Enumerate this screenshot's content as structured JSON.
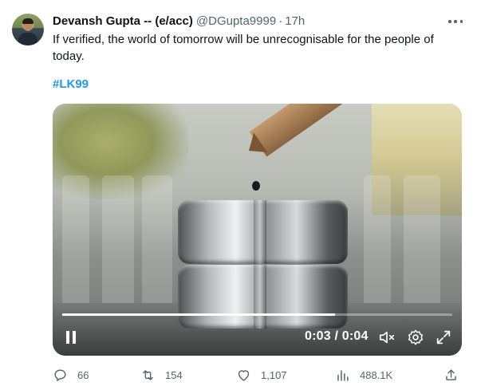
{
  "tweet": {
    "author_name": "Devansh Gupta -- (e/acc)",
    "handle": "@DGupta9999",
    "separator": "·",
    "time": "17h",
    "text": "If verified, the world of tomorrow will be unrecognisable for the people of today.",
    "hashtag": "#LK99"
  },
  "video": {
    "time_label": "0:03 / 0:04",
    "progress": 0.7,
    "playing": true
  },
  "actions": {
    "replies": "66",
    "retweets": "154",
    "likes": "1,107",
    "views": "488.1K"
  },
  "icons": {
    "more": "more-horizontal-icon",
    "pause": "pause-icon",
    "mute": "volume-muted-icon",
    "settings": "gear-icon",
    "fullscreen": "expand-icon",
    "reply": "reply-bubble-icon",
    "retweet": "retweet-icon",
    "like": "heart-icon",
    "views": "bar-chart-icon",
    "share": "share-icon"
  },
  "colors": {
    "accent": "#1d9bf0",
    "secondary_text": "#536471",
    "primary_text": "#0f1419"
  }
}
